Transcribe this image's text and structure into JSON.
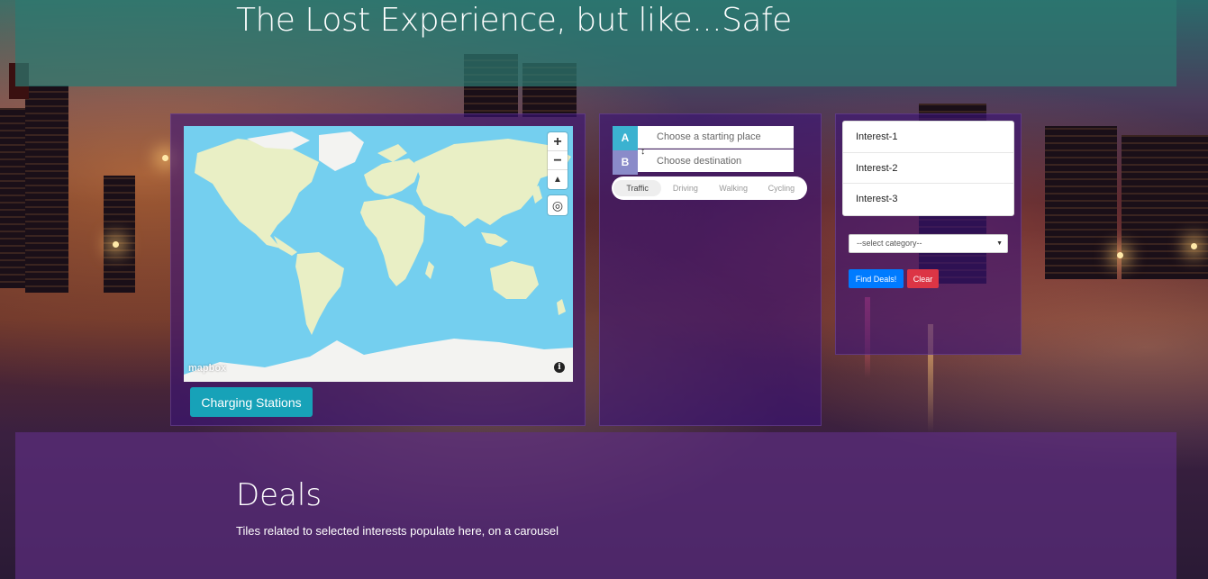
{
  "header": {
    "title": "The Lost Experience, but like...Safe"
  },
  "map": {
    "zoom_in": "+",
    "zoom_out": "−",
    "compass": "▲",
    "geolocate": "◎",
    "attribution_logo": "mapbox",
    "info": "i",
    "charging_button": "Charging Stations"
  },
  "directions": {
    "label_a": "A",
    "label_b": "B",
    "origin_placeholder": "Choose a starting place",
    "destination_placeholder": "Choose destination",
    "swap": "↕",
    "profiles": [
      "Traffic",
      "Driving",
      "Walking",
      "Cycling"
    ],
    "active_profile": "Traffic"
  },
  "interests": {
    "items": [
      "Interest-1",
      "Interest-2",
      "Interest-3"
    ],
    "category_select": "--select category--",
    "find_button": "Find Deals!",
    "clear_button": "Clear"
  },
  "deals": {
    "title": "Deals",
    "subtitle": "Tiles related to selected interests populate here, on a carousel"
  },
  "colors": {
    "map_water": "#74cfef",
    "map_land": "#e9efc5",
    "ice": "#f3f3f1",
    "charging_button": "#17a2b8",
    "find_button": "#007bff",
    "clear_button": "#dc3545"
  }
}
